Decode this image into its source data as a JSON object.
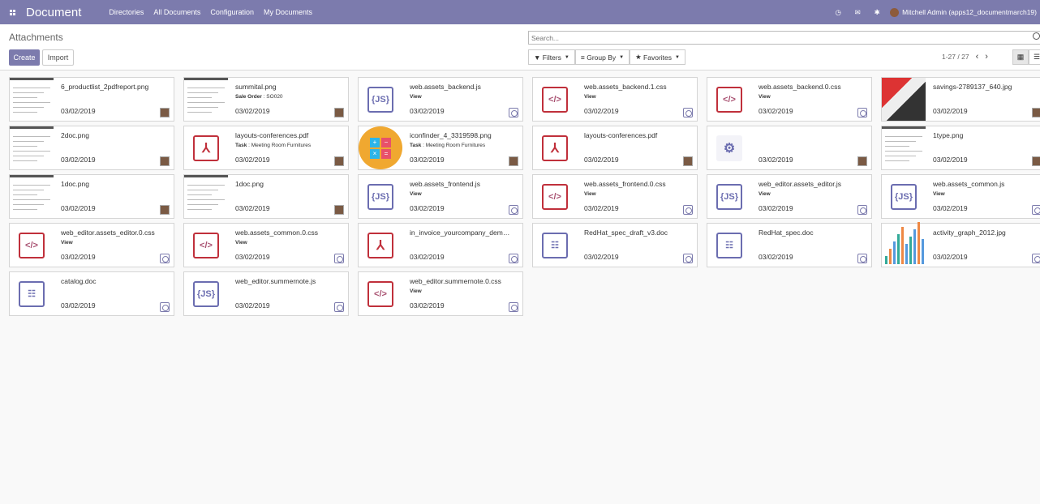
{
  "app": {
    "name": "Document",
    "menu": [
      "Directories",
      "All Documents",
      "Configuration",
      "My Documents"
    ],
    "user": "Mitchell Admin (apps12_documentmarch19)"
  },
  "control": {
    "breadcrumb": "Attachments",
    "create": "Create",
    "import": "Import",
    "search_placeholder": "Search...",
    "filters": "Filters",
    "group_by": "Group By",
    "favorites": "Favorites",
    "pager": "1-27 / 27"
  },
  "cards": [
    {
      "name": "6_productlist_2pdfreport.png",
      "sub_label": "",
      "sub_value": "",
      "date": "03/02/2019",
      "thumb": "shot",
      "owner": "user"
    },
    {
      "name": "summital.png",
      "sub_label": "Sale Order",
      "sub_value": " : SO020",
      "date": "03/02/2019",
      "thumb": "shot",
      "owner": "user"
    },
    {
      "name": "web.assets_backend.js",
      "sub_label": "View",
      "sub_value": "",
      "date": "03/02/2019",
      "thumb": "js",
      "owner": "none"
    },
    {
      "name": "web.assets_backend.1.css",
      "sub_label": "View",
      "sub_value": "",
      "date": "03/02/2019",
      "thumb": "css",
      "owner": "none"
    },
    {
      "name": "web.assets_backend.0.css",
      "sub_label": "View",
      "sub_value": "",
      "date": "03/02/2019",
      "thumb": "css",
      "owner": "none"
    },
    {
      "name": "savings-2789137_640.jpg",
      "sub_label": "",
      "sub_value": "",
      "date": "03/02/2019",
      "thumb": "savings",
      "owner": "user"
    },
    {
      "name": "2doc.png",
      "sub_label": "",
      "sub_value": "",
      "date": "03/02/2019",
      "thumb": "shot",
      "owner": "user"
    },
    {
      "name": "layouts-conferences.pdf",
      "sub_label": "Task",
      "sub_value": " : Meeting Room Furnitures",
      "date": "03/02/2019",
      "thumb": "pdf",
      "owner": "user"
    },
    {
      "name": "iconfinder_4_3319598.png",
      "sub_label": "Task",
      "sub_value": " : Meeting Room Furnitures",
      "date": "03/02/2019",
      "thumb": "calc",
      "owner": "user"
    },
    {
      "name": "layouts-conferences.pdf",
      "sub_label": "",
      "sub_value": "",
      "date": "03/02/2019",
      "thumb": "pdf",
      "owner": "user"
    },
    {
      "name": "",
      "sub_label": "",
      "sub_value": "",
      "date": "03/02/2019",
      "thumb": "gear",
      "owner": "user"
    },
    {
      "name": "1type.png",
      "sub_label": "",
      "sub_value": "",
      "date": "03/02/2019",
      "thumb": "shot",
      "owner": "user"
    },
    {
      "name": "1doc.png",
      "sub_label": "",
      "sub_value": "",
      "date": "03/02/2019",
      "thumb": "shot",
      "owner": "user"
    },
    {
      "name": "1doc.png",
      "sub_label": "",
      "sub_value": "",
      "date": "03/02/2019",
      "thumb": "shot",
      "owner": "user"
    },
    {
      "name": "web.assets_frontend.js",
      "sub_label": "View",
      "sub_value": "",
      "date": "03/02/2019",
      "thumb": "js",
      "owner": "none"
    },
    {
      "name": "web.assets_frontend.0.css",
      "sub_label": "View",
      "sub_value": "",
      "date": "03/02/2019",
      "thumb": "css",
      "owner": "none"
    },
    {
      "name": "web_editor.assets_editor.js",
      "sub_label": "View",
      "sub_value": "",
      "date": "03/02/2019",
      "thumb": "js",
      "owner": "none"
    },
    {
      "name": "web.assets_common.js",
      "sub_label": "View",
      "sub_value": "",
      "date": "03/02/2019",
      "thumb": "js",
      "owner": "none"
    },
    {
      "name": "web_editor.assets_editor.0.css",
      "sub_label": "View",
      "sub_value": "",
      "date": "03/02/2019",
      "thumb": "css",
      "owner": "none"
    },
    {
      "name": "web.assets_common.0.css",
      "sub_label": "View",
      "sub_value": "",
      "date": "03/02/2019",
      "thumb": "css",
      "owner": "none"
    },
    {
      "name": "in_invoice_yourcompany_dem…",
      "sub_label": "",
      "sub_value": "",
      "date": "03/02/2019",
      "thumb": "pdf",
      "owner": "none"
    },
    {
      "name": "RedHat_spec_draft_v3.doc",
      "sub_label": "",
      "sub_value": "",
      "date": "03/02/2019",
      "thumb": "doc",
      "owner": "none"
    },
    {
      "name": "RedHat_spec.doc",
      "sub_label": "",
      "sub_value": "",
      "date": "03/02/2019",
      "thumb": "doc",
      "owner": "none"
    },
    {
      "name": "activity_graph_2012.jpg",
      "sub_label": "",
      "sub_value": "",
      "date": "03/02/2019",
      "thumb": "graph",
      "owner": "none"
    },
    {
      "name": "catalog.doc",
      "sub_label": "",
      "sub_value": "",
      "date": "03/02/2019",
      "thumb": "doc",
      "owner": "none"
    },
    {
      "name": "web_editor.summernote.js",
      "sub_label": "",
      "sub_value": "",
      "date": "03/02/2019",
      "thumb": "js",
      "owner": "none"
    },
    {
      "name": "web_editor.summernote.0.css",
      "sub_label": "View",
      "sub_value": "",
      "date": "03/02/2019",
      "thumb": "css",
      "owner": "none"
    }
  ]
}
